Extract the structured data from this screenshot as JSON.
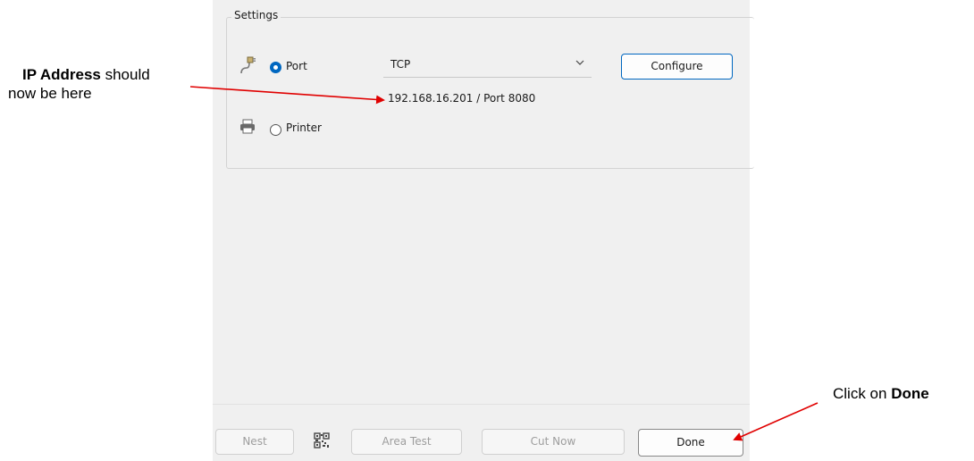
{
  "settings": {
    "group_title": "Settings",
    "port_option": {
      "label": "Port",
      "selected": true
    },
    "port_select": {
      "value": "TCP"
    },
    "configure_label": "Configure",
    "address_text": "192.168.16.201 / Port 8080",
    "printer_option": {
      "label": "Printer",
      "selected": false
    }
  },
  "footer": {
    "nest_label": "Nest",
    "area_test_label": "Area Test",
    "cut_now_label": "Cut Now",
    "done_label": "Done"
  },
  "annotations": {
    "ip_bold": "IP Address",
    "ip_rest1": " should",
    "ip_rest2": "now be here",
    "done_pre": "Click on ",
    "done_bold": "Done"
  },
  "colors": {
    "accent": "#0067c0",
    "arrow": "#e00000",
    "panel_bg": "#f0f0f0"
  }
}
